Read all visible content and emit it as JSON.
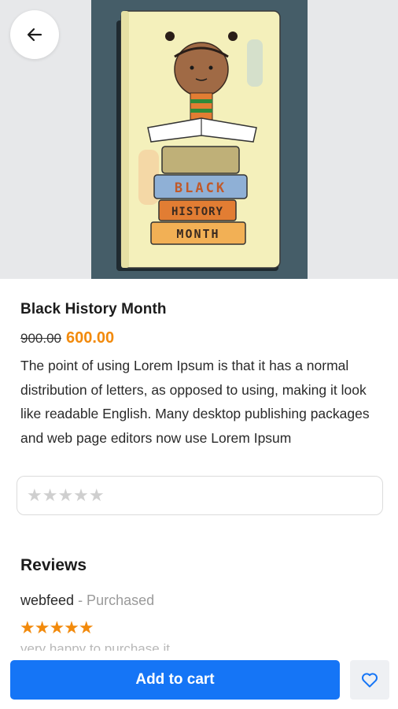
{
  "product": {
    "title": "Black History Month",
    "old_price": "900.00",
    "price": "600.00",
    "description": "The point of using Lorem Ipsum is that it has a normal distribution of letters, as opposed to using, making it look like readable English. Many desktop publishing packages and web page editors now use Lorem Ipsum",
    "cover_lines": [
      "BLACK",
      "HISTORY",
      "MONTH"
    ]
  },
  "rating_input": {
    "stars": "★★★★★",
    "value": 0,
    "max": 5
  },
  "reviews": {
    "title": "Reviews",
    "items": [
      {
        "author": "webfeed",
        "tag": " - Purchased",
        "stars": "★★★★★",
        "rating": 5,
        "text": "very happy to purchase it"
      }
    ]
  },
  "actions": {
    "add_to_cart": "Add to cart"
  },
  "icons": {
    "back": "arrow-left-icon",
    "wishlist": "heart-outline-icon"
  },
  "colors": {
    "accent_blue": "#1575f6",
    "price_orange": "#f28a0c",
    "star_empty": "#cfcfcf"
  }
}
